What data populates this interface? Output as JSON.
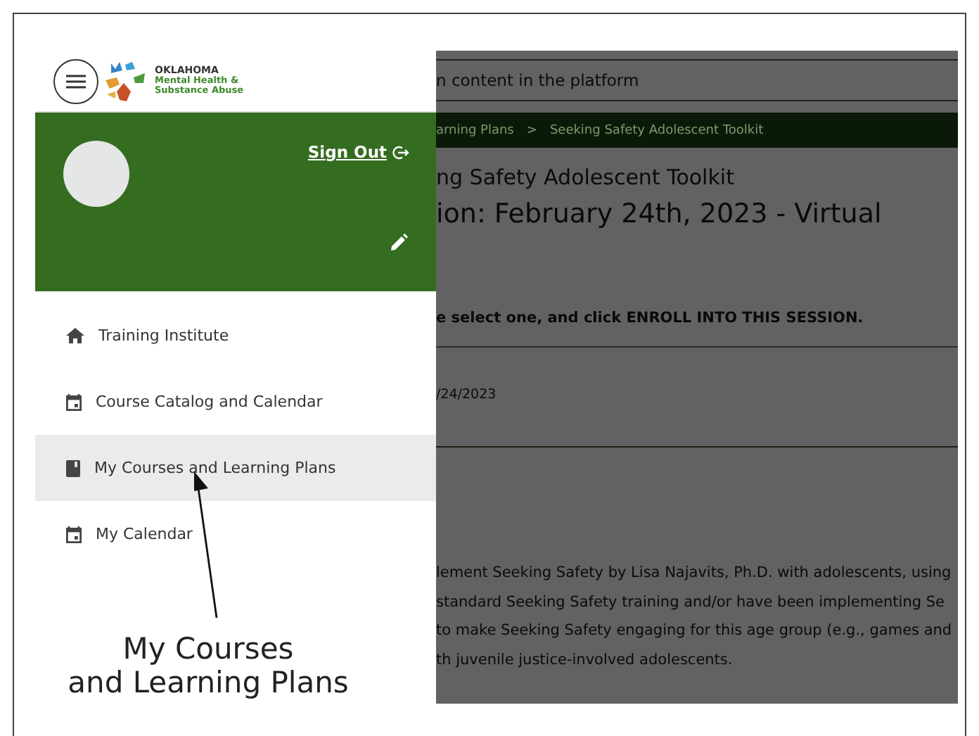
{
  "logo": {
    "title": "OKLAHOMA",
    "line_1": "Mental Health &",
    "line_2": "Substance Abuse"
  },
  "profile": {
    "sign_out": "Sign Out"
  },
  "nav": [
    {
      "label": "Training Institute",
      "selected": false
    },
    {
      "label": "Course Catalog and Calendar",
      "selected": false
    },
    {
      "label": "My Courses and Learning Plans",
      "selected": true
    },
    {
      "label": "My Calendar",
      "selected": false
    }
  ],
  "background_page": {
    "search_placeholder": "n content in the platform",
    "breadcrumb": [
      "arning Plans",
      "Seeking Safety Adolescent Toolkit"
    ],
    "breadcrumb_separator": ">",
    "course_title": "ng Safety Adolescent Toolkit",
    "session_title": "ion:  February 24th, 2023 - Virtual",
    "instruction": "e select one, and click ENROLL INTO THIS SESSION.",
    "session_date": "/24/2023",
    "description": [
      "lement Seeking Safety by Lisa Najavits, Ph.D. with adolescents, using",
      "standard Seeking Safety training and/or have been implementing Se",
      "to make Seeking Safety engaging for this age group (e.g., games and",
      "th juvenile justice-involved adolescents."
    ]
  },
  "annotation": {
    "lines": [
      "My Courses",
      "and Learning Plans"
    ]
  }
}
